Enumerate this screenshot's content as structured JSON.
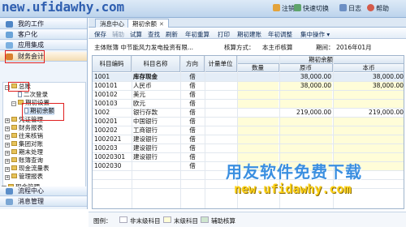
{
  "banner": {
    "text": "new.ufidawhy.com"
  },
  "topmenu": {
    "logout": "注销",
    "quick_switch": "快速切换",
    "log": "日志",
    "help": "帮助"
  },
  "sidebar": {
    "nav_top": [
      {
        "label": "我的工作"
      },
      {
        "label": "客户化"
      },
      {
        "label": "应用集成"
      },
      {
        "label": "财务会计"
      }
    ],
    "tree": [
      {
        "label": "总账",
        "type": "folder",
        "expanded": true
      },
      {
        "label": "二次登录",
        "type": "doc"
      },
      {
        "label": "期初设置",
        "type": "folder",
        "expanded": true
      },
      {
        "label": "期初余额",
        "type": "doc",
        "selected": true
      },
      {
        "label": "凭证管理",
        "type": "folder"
      },
      {
        "label": "财务报表",
        "type": "folder"
      },
      {
        "label": "往来核销",
        "type": "folder"
      },
      {
        "label": "集团对账",
        "type": "folder"
      },
      {
        "label": "期末处理",
        "type": "folder"
      },
      {
        "label": "账簿查询",
        "type": "folder"
      },
      {
        "label": "现金流量表",
        "type": "folder"
      },
      {
        "label": "管理报表",
        "type": "folder"
      },
      {
        "label": "现金管理",
        "type": "folder"
      }
    ],
    "nav_bottom": [
      {
        "label": "流程中心"
      },
      {
        "label": "消息管理"
      }
    ]
  },
  "tabs": [
    {
      "label": "消息中心"
    },
    {
      "label": "期初余额",
      "active": true
    }
  ],
  "toolbar": [
    "保存",
    "辅助",
    "试算",
    "查找",
    "刷新",
    "年初重算",
    "打印",
    "期初建账",
    "年初调整",
    "集中操作 ▾"
  ],
  "info": {
    "entity": "主体账簿 中节能风力发电投资有限...",
    "method_label": "核算方式：",
    "method_value": "本主币核算",
    "period_label": "期间：",
    "period_value": "2016年01月"
  },
  "grid": {
    "headers": {
      "code": "科目编码",
      "name": "科目名称",
      "direction": "方向",
      "unit": "计量单位",
      "group": "期初余额",
      "qty": "数量",
      "orig": "原币",
      "local": "本币"
    },
    "rows": [
      {
        "code": "1001",
        "name": "库存现金",
        "dir": "借",
        "unit": "",
        "qty": "",
        "orig": "38,000.00",
        "local": "38,000.00",
        "bold": true
      },
      {
        "code": "100101",
        "name": "人民币",
        "dir": "借",
        "unit": "",
        "qty": "",
        "orig": "38,000.00",
        "local": "38,000.00"
      },
      {
        "code": "100102",
        "name": "美元",
        "dir": "借",
        "unit": "",
        "qty": "",
        "orig": "",
        "local": ""
      },
      {
        "code": "100103",
        "name": "欧元",
        "dir": "借",
        "unit": "",
        "qty": "",
        "orig": "",
        "local": ""
      },
      {
        "code": "1002",
        "name": "银行存款",
        "dir": "借",
        "unit": "",
        "qty": "",
        "orig": "219,000.00",
        "local": "219,000.00"
      },
      {
        "code": "100201",
        "name": "中国银行",
        "dir": "借",
        "unit": "",
        "qty": "",
        "orig": "",
        "local": ""
      },
      {
        "code": "100202",
        "name": "工商银行",
        "dir": "借",
        "unit": "",
        "qty": "",
        "orig": "",
        "local": ""
      },
      {
        "code": "1002021",
        "name": "建设银行",
        "dir": "借",
        "unit": "",
        "qty": "",
        "orig": "",
        "local": ""
      },
      {
        "code": "100203",
        "name": "建设银行",
        "dir": "借",
        "unit": "",
        "qty": "",
        "orig": "",
        "local": ""
      },
      {
        "code": "10020301",
        "name": "建设银行",
        "dir": "借",
        "unit": "",
        "qty": "",
        "orig": "",
        "local": ""
      },
      {
        "code": "1002030",
        "name": "",
        "dir": "借",
        "unit": "",
        "qty": "",
        "orig": "",
        "local": ""
      },
      {
        "code": "",
        "name": "",
        "dir": "",
        "unit": "",
        "qty": "",
        "orig": "",
        "local": ""
      },
      {
        "code": "",
        "name": "",
        "dir": "",
        "unit": "",
        "qty": "",
        "orig": "",
        "local": ""
      }
    ]
  },
  "legend": {
    "label": "图例：",
    "items": [
      "非末级科目",
      "末级科目",
      "辅助核算"
    ]
  },
  "watermark": {
    "line1": "用友软件免费下载",
    "line2": "new.ufidawhy.com"
  },
  "colors": {
    "accent": "#2f5fb0",
    "highlight_red": "#e02020",
    "input_yellow": "#fffdd8"
  }
}
